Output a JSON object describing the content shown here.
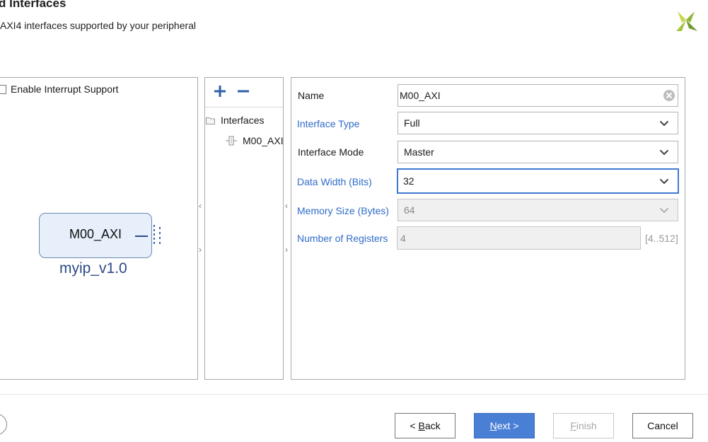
{
  "header": {
    "title": "d Interfaces",
    "subtitle": "AXI4 interfaces supported by your peripheral"
  },
  "left_panel": {
    "interrupt_label": "Enable Interrupt Support",
    "interrupt_checked": false,
    "ip_port_label": "M00_AXI",
    "ip_name": "myip_v1.0"
  },
  "middle_panel": {
    "tree_root": "Interfaces",
    "tree_child": "M00_AXI"
  },
  "form": {
    "name_label": "Name",
    "name_value": "M00_AXI",
    "type_label": "Interface Type",
    "type_value": "Full",
    "mode_label": "Interface Mode",
    "mode_value": "Master",
    "width_label": "Data Width (Bits)",
    "width_value": "32",
    "memsize_label": "Memory Size (Bytes)",
    "memsize_value": "64",
    "registers_label": "Number of Registers",
    "registers_value": "4",
    "registers_range": "[4..512]"
  },
  "buttons": {
    "back_prefix": "< ",
    "back_mnemonic": "B",
    "back_rest": "ack",
    "next_mnemonic": "N",
    "next_rest": "ext >",
    "finish_mnemonic": "F",
    "finish_rest": "inish",
    "cancel": "Cancel"
  },
  "colors": {
    "accent_blue": "#2f6cc8",
    "primary_button": "#4a7fd6",
    "logo_green": "#8fb83a"
  }
}
